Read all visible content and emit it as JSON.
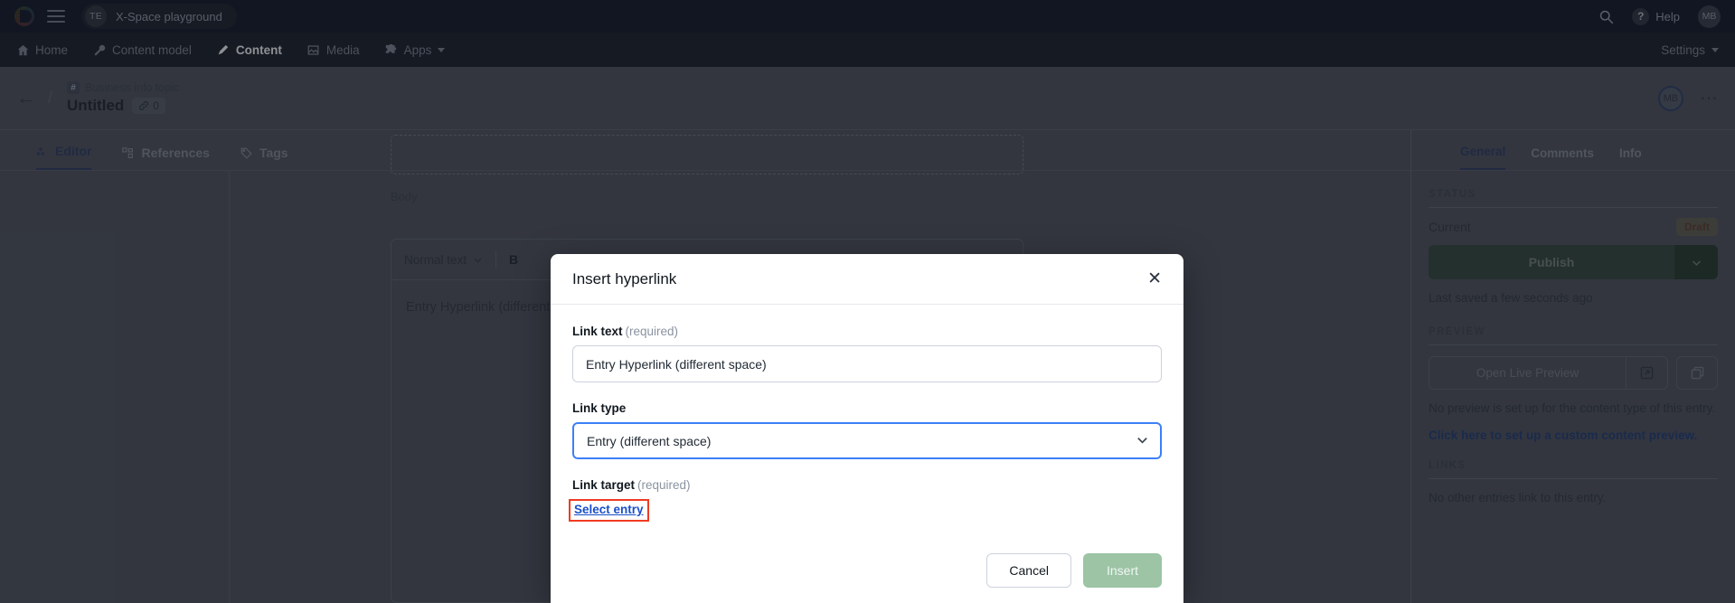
{
  "topbar": {
    "logo": "contentful-logo",
    "space_initials": "TE",
    "space_name": "X-Space playground",
    "search_icon": "search-icon",
    "help_label": "Help",
    "user_initials": "MB"
  },
  "nav": {
    "items": [
      {
        "label": "Home",
        "icon": "home-icon",
        "active": false
      },
      {
        "label": "Content model",
        "icon": "wrench-icon",
        "active": false
      },
      {
        "label": "Content",
        "icon": "pen-icon",
        "active": true
      },
      {
        "label": "Media",
        "icon": "image-icon",
        "active": false
      },
      {
        "label": "Apps",
        "icon": "puzzle-icon",
        "active": false
      }
    ],
    "settings_label": "Settings"
  },
  "entry_header": {
    "back_icon": "back-arrow-icon",
    "content_type_badge": "#",
    "content_type": "Business info topic",
    "title": "Untitled",
    "link_icon": "link-icon",
    "link_count": "0",
    "avatar_initials": "MB",
    "more_icon": "more-options-icon"
  },
  "editor_tabs": [
    {
      "label": "Editor",
      "icon": "editor-icon",
      "active": true
    },
    {
      "label": "References",
      "icon": "references-icon",
      "active": false
    },
    {
      "label": "Tags",
      "icon": "tag-icon",
      "active": false
    }
  ],
  "editor": {
    "body_field_label": "Body",
    "toolbar": {
      "style_select": "Normal text",
      "bold_label": "B"
    },
    "rte_text": "Entry Hyperlink (different space)"
  },
  "modal": {
    "title": "Insert hyperlink",
    "close_icon": "close-icon",
    "link_text": {
      "label": "Link text",
      "required_note": "(required)",
      "value": "Entry Hyperlink (different space)"
    },
    "link_type": {
      "label": "Link type",
      "value": "Entry (different space)",
      "caret_icon": "chevron-down-icon"
    },
    "link_target": {
      "label": "Link target",
      "required_note": "(required)",
      "action_label": "Select entry",
      "highlight_color": "#f03b21"
    },
    "cancel_label": "Cancel",
    "insert_label": "Insert"
  },
  "sidebar": {
    "tabs": [
      {
        "label": "General",
        "active": true
      },
      {
        "label": "Comments",
        "active": false
      },
      {
        "label": "Info",
        "active": false
      }
    ],
    "status": {
      "section_title": "STATUS",
      "current_label": "Current",
      "status_badge": "Draft",
      "publish_label": "Publish",
      "publish_caret_icon": "chevron-down-icon",
      "saved_text": "Last saved a few seconds ago"
    },
    "preview": {
      "section_title": "PREVIEW",
      "open_label": "Open Live Preview",
      "external_icon": "external-link-icon",
      "copy_icon": "copy-icon",
      "note": "No preview is set up for the content type of this entry.",
      "setup_link": "Click here to set up a custom content preview."
    },
    "links": {
      "section_title": "LINKS",
      "note": "No other entries link to this entry."
    }
  }
}
